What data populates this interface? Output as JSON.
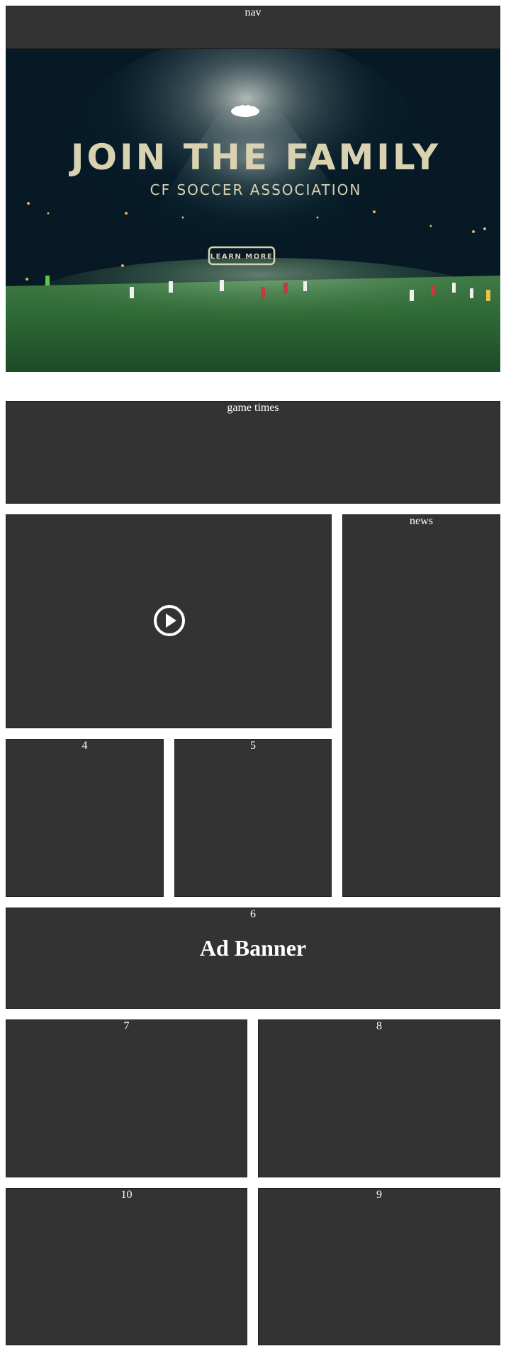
{
  "nav": {
    "label": "nav"
  },
  "hero": {
    "headline": "JOIN THE FAMILY",
    "subheadline": "CF SOCCER ASSOCIATION",
    "cta_label": "LEARN MORE"
  },
  "game_times": {
    "label": "game times"
  },
  "video": {
    "icon": "play-icon"
  },
  "news": {
    "label": "news"
  },
  "boxes": {
    "b4": "4",
    "b5": "5",
    "b6": "6",
    "b7": "7",
    "b8": "8",
    "b9": "9",
    "b10": "10"
  },
  "ad_banner": {
    "title": "Ad Banner"
  },
  "colors": {
    "panel": "#333333",
    "hero_text": "#d9d2b0",
    "field_green": "#2f6a3a",
    "sky": "#061925"
  }
}
